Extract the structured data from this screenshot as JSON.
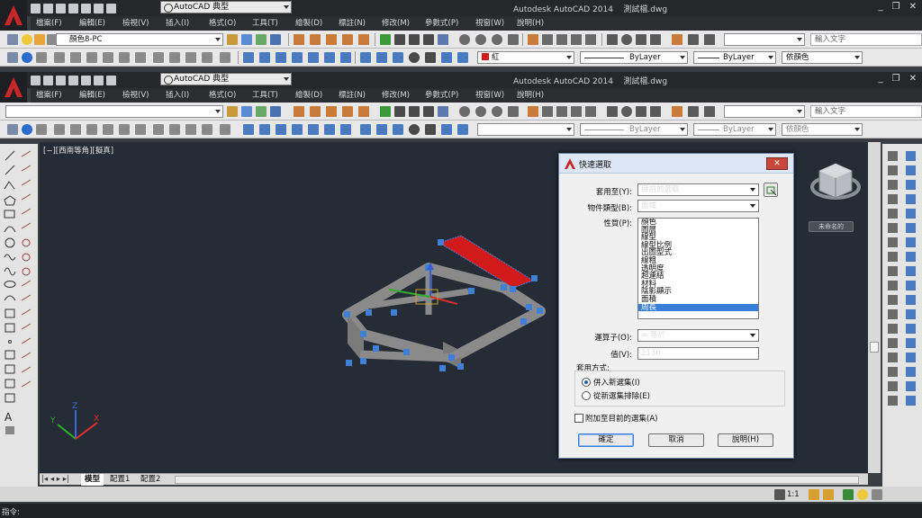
{
  "app": {
    "title": "Autodesk AutoCAD 2014",
    "filename": "測試檔.dwg",
    "workspace": "AutoCAD 典型"
  },
  "menu": [
    "檔案(F)",
    "編輯(E)",
    "檢視(V)",
    "插入(I)",
    "格式(O)",
    "工具(T)",
    "繪製(D)",
    "標註(N)",
    "修改(M)",
    "參數式(P)",
    "視窗(W)",
    "說明(H)"
  ],
  "toolbar": {
    "layer_value": "顏色8-PC",
    "search_placeholder": "輸入文字",
    "color_value": "紅",
    "color_value_second": "",
    "linetype": "ByLayer",
    "lineweight": "ByLayer",
    "plotstyle": "依顏色"
  },
  "viewport": {
    "label": "[−][西南等角][擬真]",
    "navcube_label": "未命名的"
  },
  "dialog": {
    "title": "快速選取",
    "apply_to_label": "套用至(Y):",
    "apply_to_value": "目前的選取",
    "object_type_label": "物件類型(B):",
    "object_type_value": "面域",
    "properties_label": "性質(P):",
    "properties": [
      "顏色",
      "圖層",
      "線型",
      "線型比例",
      "出圖型式",
      "線粗",
      "透明度",
      "超連結",
      "材料",
      "陰影顯示",
      "面積",
      "周長"
    ],
    "selected_property": "周長",
    "operator_label": "運算子(O):",
    "operator_value": "= 等於",
    "value_label": "值(V):",
    "value_value": "2130",
    "how_to_apply_label": "套用方式:",
    "include_label": "併入新選集(I)",
    "exclude_label": "從新選集排除(E)",
    "append_label": "附加至目前的選集(A)",
    "ok_label": "確定",
    "cancel_label": "取消",
    "help_label": "說明(H)"
  },
  "tabs": [
    "模型",
    "配置1",
    "配置2"
  ],
  "status": {
    "scale": "1:1"
  },
  "command": {
    "prompt": "指令:"
  },
  "colors": {
    "canvas": "#262c36",
    "selected_red": "#d11a1a",
    "grip_blue": "#3f7fd6"
  }
}
